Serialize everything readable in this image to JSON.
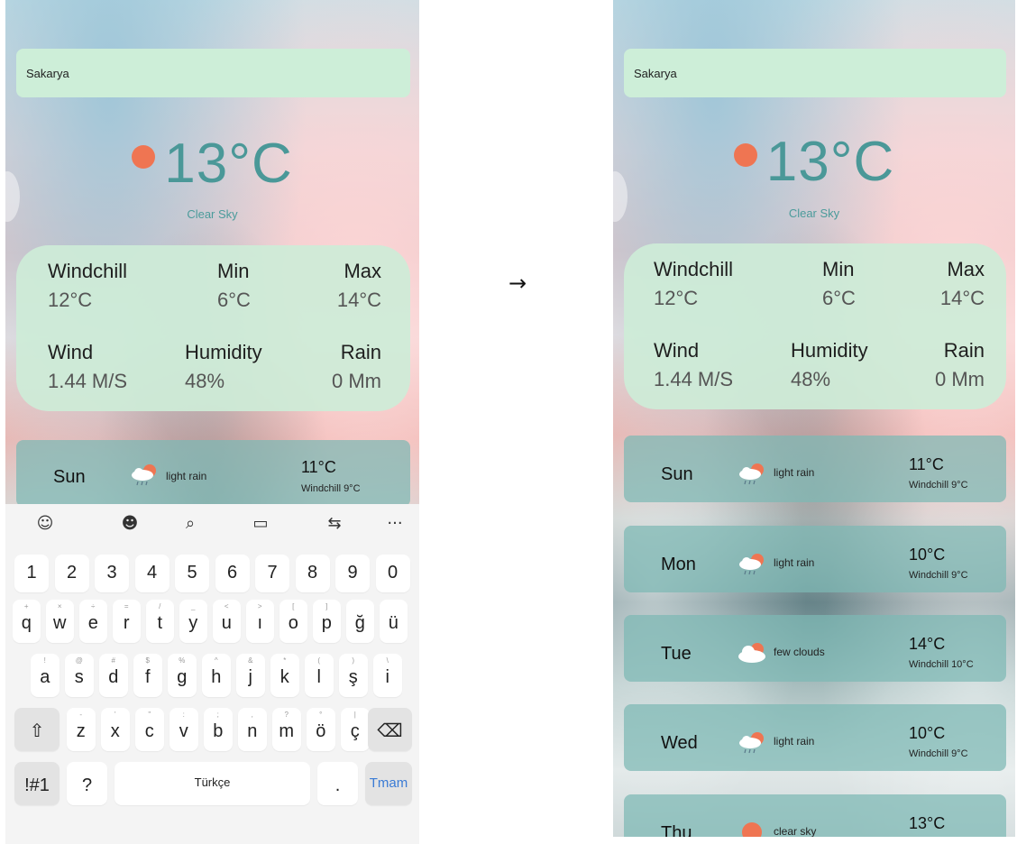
{
  "arrow": "→",
  "screens": {
    "left": {
      "city": "Sakarya",
      "temperature": "13°C",
      "condition": "Clear Sky",
      "stats": {
        "windchill_label": "Windchill",
        "windchill_value": "12°C",
        "min_label": "Min",
        "min_value": "6°C",
        "max_label": "Max",
        "max_value": "14°C",
        "wind_label": "Wind",
        "wind_value": "1.44 M/S",
        "humidity_label": "Humidity",
        "humidity_value": "48%",
        "rain_label": "Rain",
        "rain_value": "0 Mm"
      },
      "forecast": [
        {
          "day": "Sun",
          "desc": "light rain",
          "temp": "11°C",
          "windchill": "Windchill 9°C",
          "icon": "rain-cloud-icon"
        }
      ]
    },
    "right": {
      "city": "Sakarya",
      "temperature": "13°C",
      "condition": "Clear Sky",
      "stats": {
        "windchill_label": "Windchill",
        "windchill_value": "12°C",
        "min_label": "Min",
        "min_value": "6°C",
        "max_label": "Max",
        "max_value": "14°C",
        "wind_label": "Wind",
        "wind_value": "1.44 M/S",
        "humidity_label": "Humidity",
        "humidity_value": "48%",
        "rain_label": "Rain",
        "rain_value": "0 Mm"
      },
      "forecast": [
        {
          "day": "Sun",
          "desc": "light rain",
          "temp": "11°C",
          "windchill": "Windchill 9°C",
          "icon": "rain-cloud-icon"
        },
        {
          "day": "Mon",
          "desc": "light rain",
          "temp": "10°C",
          "windchill": "Windchill 9°C",
          "icon": "rain-cloud-icon"
        },
        {
          "day": "Tue",
          "desc": "few clouds",
          "temp": "14°C",
          "windchill": "Windchill 10°C",
          "icon": "cloud-icon"
        },
        {
          "day": "Wed",
          "desc": "light rain",
          "temp": "10°C",
          "windchill": "Windchill 9°C",
          "icon": "rain-cloud-icon"
        },
        {
          "day": "Thu",
          "desc": "clear sky",
          "temp": "13°C",
          "windchill": "",
          "icon": "sun-icon"
        }
      ]
    }
  },
  "keyboard": {
    "toolbar_icons": [
      "emoji-icon",
      "sticker-icon",
      "search-icon",
      "clipboard-icon",
      "translate-icon",
      "more-icon"
    ],
    "toolbar_glyphs": [
      "☺",
      "☻",
      "⌕",
      "▭",
      "⇆",
      "···"
    ],
    "row_numbers": [
      "1",
      "2",
      "3",
      "4",
      "5",
      "6",
      "7",
      "8",
      "9",
      "0"
    ],
    "row1": [
      "q",
      "w",
      "e",
      "r",
      "t",
      "y",
      "u",
      "ı",
      "o",
      "p",
      "ğ",
      "ü"
    ],
    "row1_hints": [
      "+",
      "×",
      "÷",
      "=",
      "/",
      "_",
      "<",
      ">",
      "[",
      "]",
      "",
      ""
    ],
    "row2": [
      "a",
      "s",
      "d",
      "f",
      "g",
      "h",
      "j",
      "k",
      "l",
      "ş",
      "i"
    ],
    "row2_hints": [
      "!",
      "@",
      "#",
      "$",
      "%",
      "^",
      "&",
      "*",
      "(",
      ")",
      "\\"
    ],
    "row3": [
      "z",
      "x",
      "c",
      "v",
      "b",
      "n",
      "m",
      "ö",
      "ç"
    ],
    "row3_hints": [
      "-",
      "'",
      "\"",
      ":",
      ";",
      ",",
      "?",
      "°",
      "|"
    ],
    "shift_glyph": "⇧",
    "backspace_glyph": "⌫",
    "symbols_label": "!#1",
    "question_label": "?",
    "space_label": "Türkçe",
    "period_label": ".",
    "done_label": "Tmam"
  },
  "colors": {
    "accent": "#4a9898",
    "sun": "#ef7552",
    "city_bar": "#cdeed8",
    "done_key_text": "#3a7bd5"
  }
}
